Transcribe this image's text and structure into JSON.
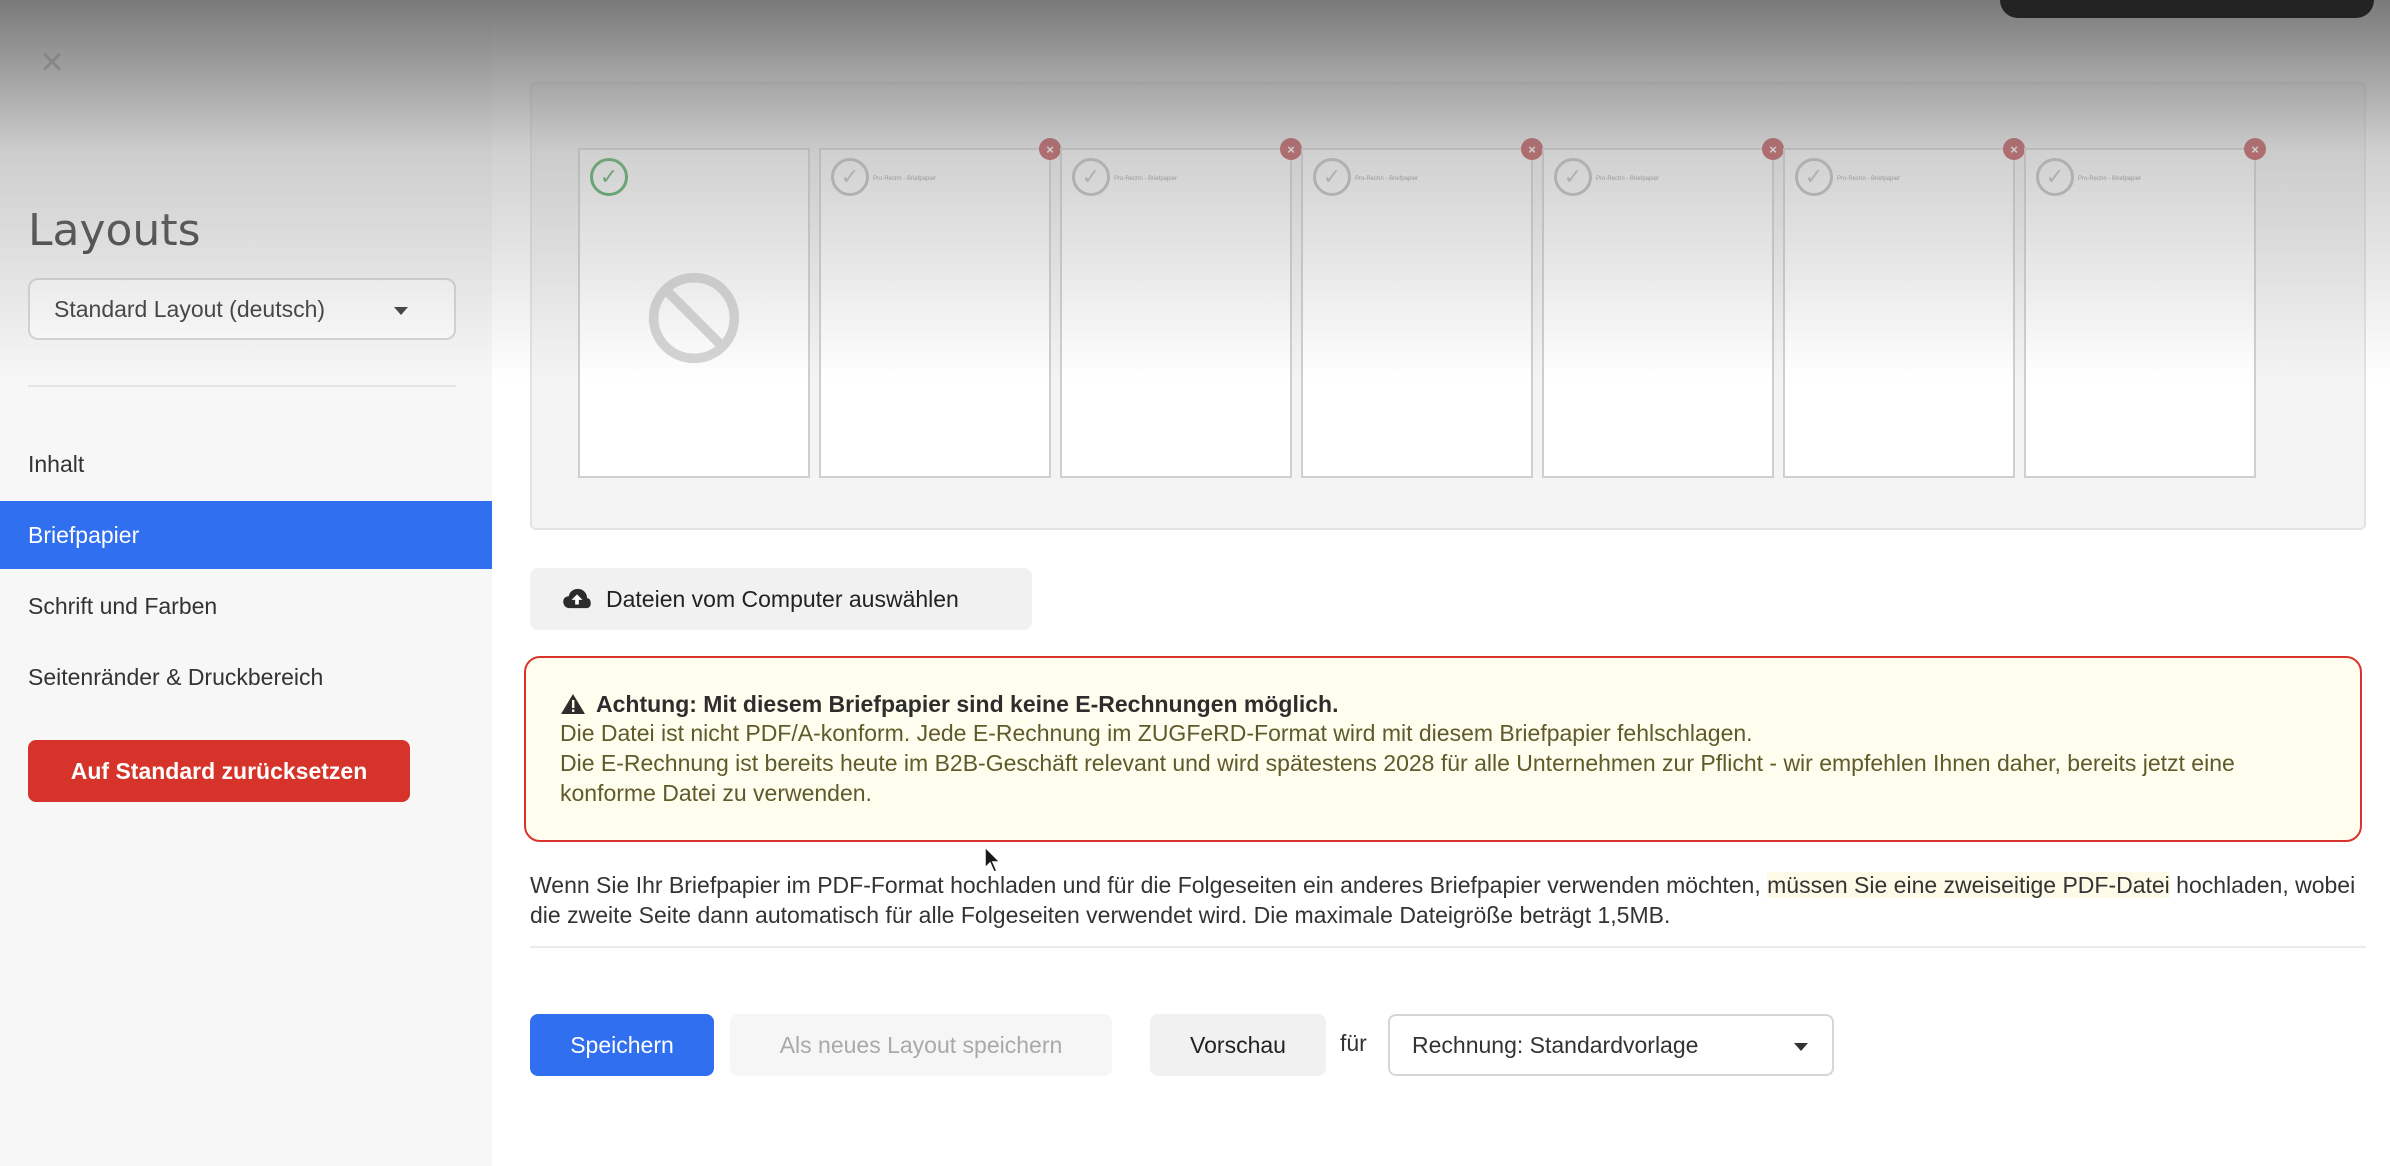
{
  "sidebar": {
    "title": "Layouts",
    "layout_select": "Standard Layout (deutsch)",
    "items": [
      {
        "label": "Inhalt"
      },
      {
        "label": "Briefpapier"
      },
      {
        "label": "Schrift und Farben"
      },
      {
        "label": "Seitenränder & Druckbereich"
      }
    ],
    "active_item": "Briefpapier",
    "reset_label": "Auf Standard zurücksetzen"
  },
  "thumbnails": {
    "mini_text": "Pro-Rechn - Briefpapier"
  },
  "upload": {
    "label": "Dateien vom Computer auswählen"
  },
  "warning": {
    "title": "Achtung: Mit diesem Briefpapier sind keine E-Rechnungen möglich.",
    "line1": "Die Datei ist nicht PDF/A-konform. Jede E-Rechnung im ZUGFeRD-Format wird mit diesem Briefpapier fehlschlagen.",
    "line2": "Die E-Rechnung ist bereits heute im B2B-Geschäft relevant und wird spätestens 2028 für alle Unternehmen zur Pflicht - wir empfehlen Ihnen daher, bereits jetzt eine konforme Datei zu verwenden."
  },
  "info": {
    "text_part1": "Wenn Sie Ihr Briefpapier im PDF-Format hochladen und für die Folgeseiten ein anderes Briefpapier verwenden möchten, ",
    "text_highlight": "müssen Sie eine zweiseitige PDF-Datei",
    "text_part2": " hochladen, wobei die zweite Seite dann automatisch für alle Folgeseiten verwendet wird. Die maximale Dateigröße beträgt 1,5MB."
  },
  "actions": {
    "save_label": "Speichern",
    "save_new_label": "Als neues Layout speichern",
    "preview_label": "Vorschau",
    "for_label": "für",
    "template_select": "Rechnung: Standardvorlage"
  },
  "colors": {
    "accent": "#2f6ff0",
    "danger": "#d6342a",
    "success": "#2f9e44"
  }
}
